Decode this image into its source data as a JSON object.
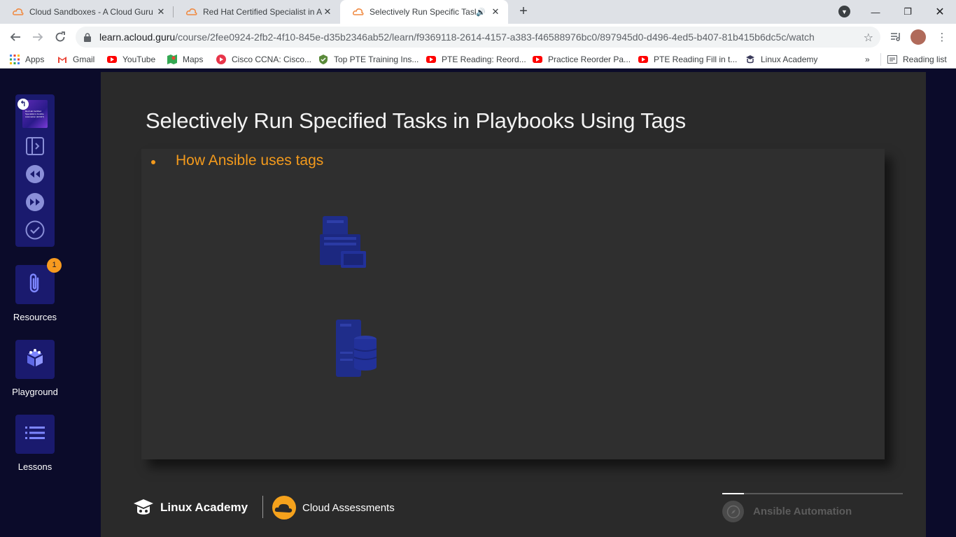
{
  "browser": {
    "tabs": [
      {
        "title": "Cloud Sandboxes - A Cloud Guru",
        "active": false,
        "icon": "acloudguru-icon"
      },
      {
        "title": "Red Hat Certified Specialist in An",
        "active": false,
        "icon": "acloudguru-icon"
      },
      {
        "title": "Selectively Run Specific Tasks",
        "active": true,
        "icon": "acloudguru-icon",
        "audio": true
      }
    ],
    "address": {
      "domain": "learn.acloud.guru",
      "path": "/course/2fee0924-2fb2-4f10-845e-d35b2346ab52/learn/f9369118-2614-4157-a383-f46588976bc0/897945d0-d496-4ed5-b407-81b415b6dc5c/watch"
    },
    "bookmarks": [
      {
        "label": "Apps",
        "icon": "apps-grid-icon"
      },
      {
        "label": "Gmail",
        "icon": "gmail-icon"
      },
      {
        "label": "YouTube",
        "icon": "youtube-icon"
      },
      {
        "label": "Maps",
        "icon": "maps-icon"
      },
      {
        "label": "Cisco CCNA: Cisco...",
        "icon": "cisco-icon"
      },
      {
        "label": "Top PTE Training Ins...",
        "icon": "pte-icon"
      },
      {
        "label": "PTE Reading: Reord...",
        "icon": "youtube-icon"
      },
      {
        "label": "Practice Reorder Pa...",
        "icon": "youtube-icon"
      },
      {
        "label": "PTE Reading Fill in t...",
        "icon": "youtube-icon"
      },
      {
        "label": "Linux Academy",
        "icon": "linux-academy-icon"
      }
    ],
    "bookmarks_overflow": "»",
    "reading_list": "Reading list"
  },
  "sidebar": {
    "thumbnail_text": "Red Hat Certified Specialist in Ansible Automation (EX407)",
    "items": [
      {
        "label": "Resources",
        "icon": "paperclip-icon",
        "badge": "1"
      },
      {
        "label": "Playground",
        "icon": "cubes-icon"
      },
      {
        "label": "Lessons",
        "icon": "list-icon"
      }
    ]
  },
  "slide": {
    "title": "Selectively Run Specified Tasks in Playbooks Using Tags",
    "bullet": "How Ansible uses tags",
    "icons": [
      "control-node-server-icon",
      "database-server-icon"
    ]
  },
  "footer": {
    "brand_left": "Linux Academy",
    "brand_right": "Cloud Assessments",
    "course_label": "Ansible Automation",
    "progress": 0.12
  },
  "colors": {
    "accent": "#f39a1c",
    "sidebar_button": "#1a1a6e",
    "slide_bg": "#2a2a2a",
    "server_icon": "#1f2d8a"
  }
}
